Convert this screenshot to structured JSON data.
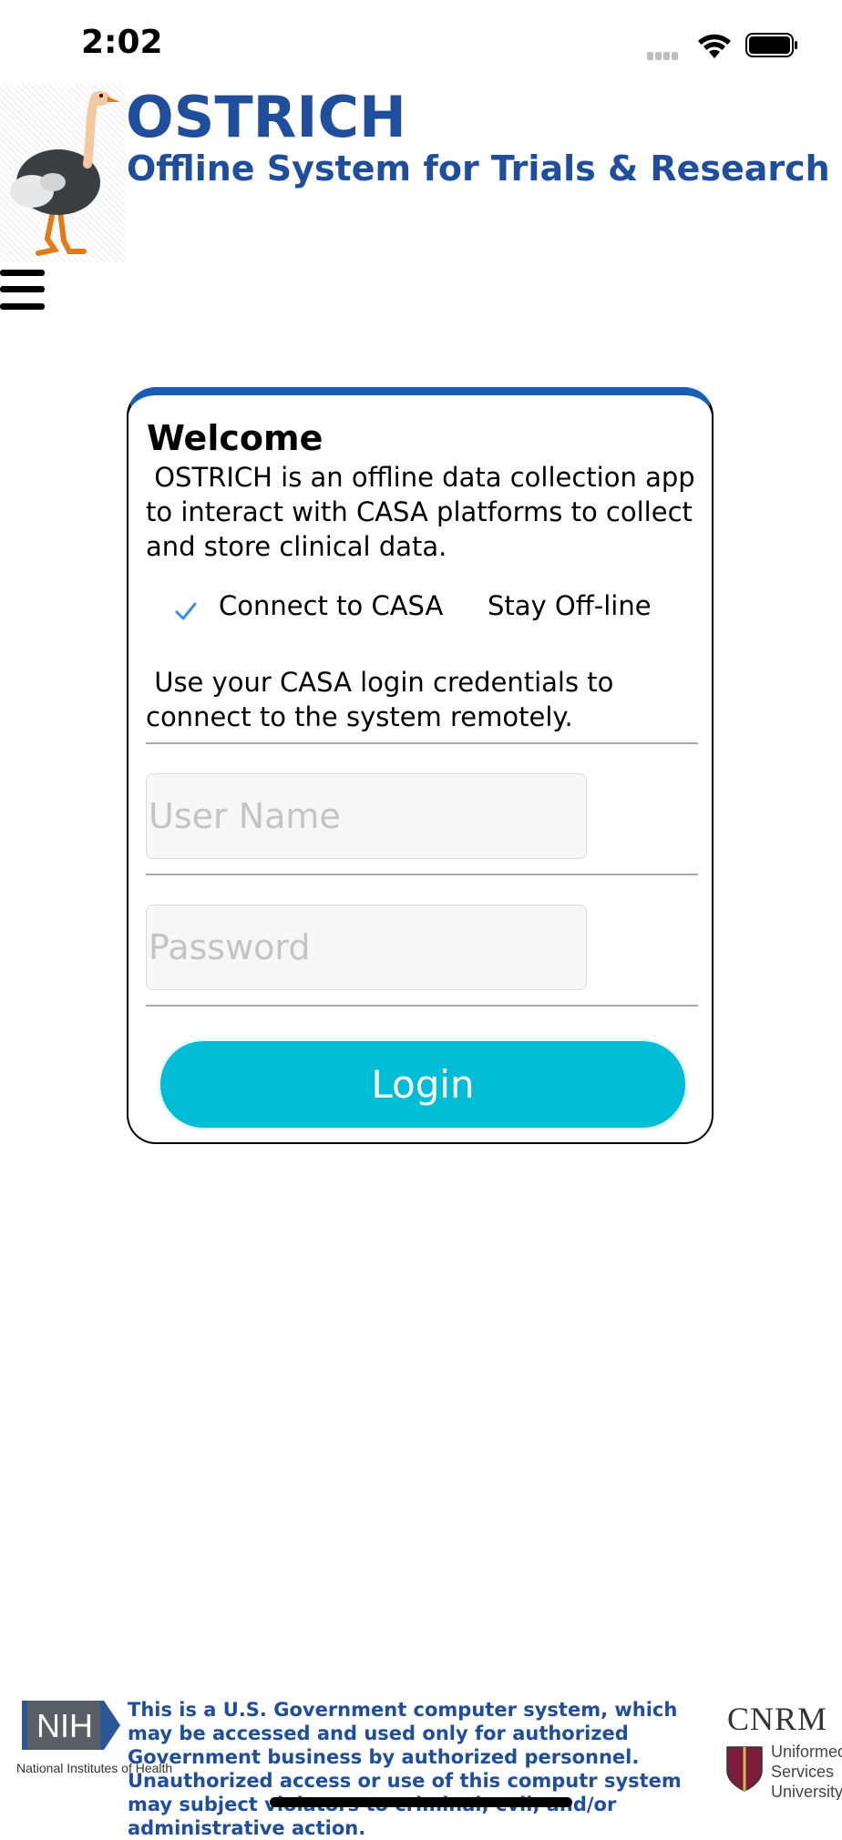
{
  "status_bar": {
    "time": "2:02",
    "icons": [
      "cellular-signal-icon",
      "wifi-icon",
      "battery-icon"
    ]
  },
  "header": {
    "title": "OSTRICH",
    "subtitle": "Offline System for Trials & Research Information Collection & Housing",
    "logo": "ostrich-logo",
    "colors": {
      "brand_blue": "#1f4e9c"
    }
  },
  "nav": {
    "menu_icon": "hamburger-menu-icon"
  },
  "welcome_card": {
    "title": "Welcome",
    "description": " OSTRICH is an offline data collection app to interact with CASA platforms to collect and store clinical data.",
    "modes": {
      "connect_label": "Connect to CASA",
      "connect_selected": true,
      "offline_label": "Stay Off-line"
    },
    "credentials_hint": " Use your CASA login credentials to connect to the system remotely.",
    "username": {
      "value": "",
      "placeholder": "User Name"
    },
    "password": {
      "value": "",
      "placeholder": "Password"
    },
    "login_label": "Login",
    "colors": {
      "card_accent": "#1a5db5",
      "login_button": "#00bcd4"
    }
  },
  "footer": {
    "nih_logo_text": "NIH",
    "nih_caption": "National Institutes of Health",
    "disclaimer": "This is a U.S. Government computer system, which may be accessed and used only for authorized Government business by authorized personnel. Unauthorized access or use of this computr system may subject violators to criminal, cvil, and/or administrative action.",
    "cnrm_text": "CNRM",
    "usu_text": "Uniformed\nServices\nUniversity"
  }
}
